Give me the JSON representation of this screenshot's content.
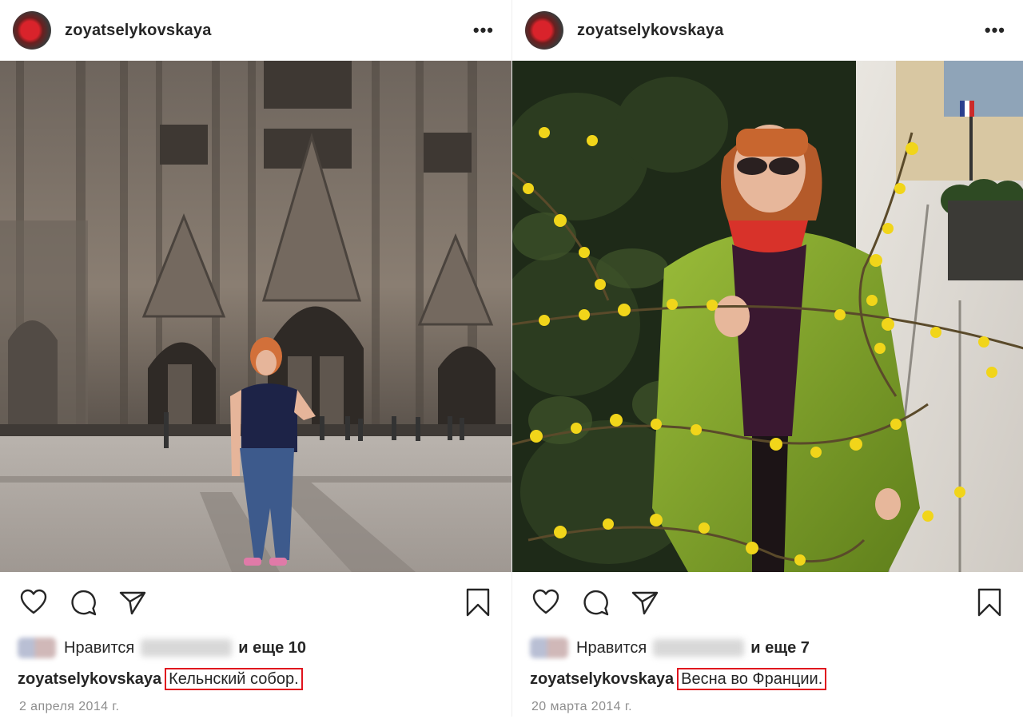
{
  "posts": [
    {
      "username": "zoyatselykovskaya",
      "more_label": "•••",
      "likes": {
        "prefix": "Нравится",
        "and_more": "и еще 10"
      },
      "caption": {
        "username": "zoyatselykovskaya",
        "text": "Кельнский собор."
      },
      "date": "2 апреля 2014 г."
    },
    {
      "username": "zoyatselykovskaya",
      "more_label": "•••",
      "likes": {
        "prefix": "Нравится",
        "and_more": "и еще 7"
      },
      "caption": {
        "username": "zoyatselykovskaya",
        "text": "Весна во Франции."
      },
      "date": "20 марта 2014 г."
    }
  ],
  "icons": {
    "like": "heart-icon",
    "comment": "comment-icon",
    "share": "paper-plane-icon",
    "save": "bookmark-icon",
    "options": "more-options-icon"
  },
  "colors": {
    "caption_highlight": "#e0141e",
    "date_text": "#8e8e8e",
    "text": "#262626"
  }
}
